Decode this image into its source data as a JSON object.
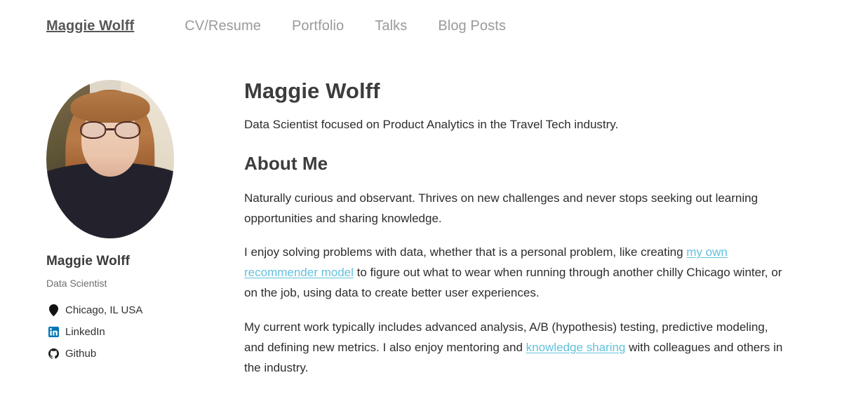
{
  "navbar": {
    "brand": "Maggie Wolff",
    "links": [
      {
        "label": "CV/Resume"
      },
      {
        "label": "Portfolio"
      },
      {
        "label": "Talks"
      },
      {
        "label": "Blog Posts"
      }
    ]
  },
  "sidebar": {
    "avatar_alt": "Profile photo of Maggie Wolff",
    "name": "Maggie Wolff",
    "role": "Data Scientist",
    "items": [
      {
        "icon": "location-pin-icon",
        "label": "Chicago, IL USA"
      },
      {
        "icon": "linkedin-icon",
        "label": "LinkedIn"
      },
      {
        "icon": "github-icon",
        "label": "Github"
      }
    ]
  },
  "main": {
    "title": "Maggie Wolff",
    "tagline": "Data Scientist focused on Product Analytics in the Travel Tech industry.",
    "about_heading": "About Me",
    "paragraph_1": "Naturally curious and observant. Thrives on new challenges and never stops seeking out learning opportunities and sharing knowledge.",
    "paragraph_2": {
      "before": "I enjoy solving problems with data, whether that is a personal problem, like creating ",
      "link": "my own recommender model",
      "after": " to figure out what to wear when running through another chilly Chicago winter, or on the job, using data to create better user experiences."
    },
    "paragraph_3": {
      "before": "My current work typically includes advanced analysis, A/B (hypothesis) testing, predictive modeling, and defining new metrics. I also enjoy mentoring and ",
      "link": "knowledge sharing",
      "after": " with colleagues and others in the industry."
    }
  },
  "colors": {
    "page_background": "#ffffff",
    "brand_text": "#575757",
    "nav_link": "#9a9a9a",
    "heading": "#3c3c3c",
    "body_text": "#2d2d2d",
    "link": "#63c1dd",
    "linkedin_blue": "#0077b5",
    "github_black": "#1b1f23"
  }
}
